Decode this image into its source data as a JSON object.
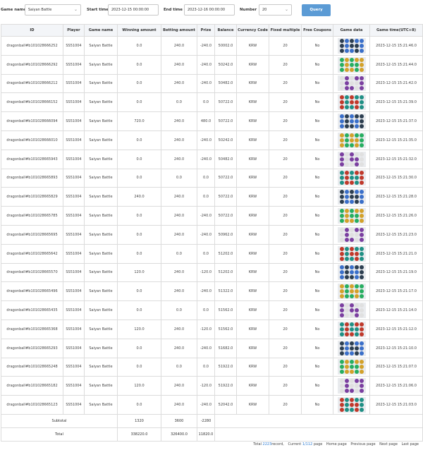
{
  "filters": {
    "game_name_label": "Game name",
    "game_name_value": "Saiyan Battle",
    "start_time_label": "Start time",
    "start_time_value": "2023-12-15 00:00:00",
    "end_time_label": "End time",
    "end_time_value": "2023-12-16 00:00:00",
    "number_label": "Number",
    "number_value": "20",
    "query_label": "Query"
  },
  "table": {
    "headers": [
      "ID",
      "Player",
      "Game name",
      "Winning amount",
      "Betting amount",
      "Prize",
      "Balance",
      "Currency Code",
      "Fixed multiple",
      "Free Coupons",
      "Game data",
      "Game time(UTC+8)"
    ],
    "rows": [
      [
        "dragonball#b101028666252",
        "SS51004",
        "Saiyan Battle",
        "0.0",
        "240.0",
        "-240.0",
        "50002.0",
        "KRW",
        "20",
        "No",
        "2023-12-15 15:21:46.0"
      ],
      [
        "dragonball#b101028666292",
        "SS51004",
        "Saiyan Battle",
        "0.0",
        "240.0",
        "-240.0",
        "50242.0",
        "KRW",
        "20",
        "No",
        "2023-12-15 15:21:44.0"
      ],
      [
        "dragonball#b101028666212",
        "SS51004",
        "Saiyan Battle",
        "0.0",
        "240.0",
        "-240.0",
        "50482.0",
        "KRW",
        "20",
        "No",
        "2023-12-15 15:21:42.0"
      ],
      [
        "dragonball#b101028666152",
        "SS51004",
        "Saiyan Battle",
        "0.0",
        "0.0",
        "0.0",
        "50722.0",
        "KRW",
        "20",
        "No",
        "2023-12-15 15:21:39.0"
      ],
      [
        "dragonball#b101028666094",
        "SS51004",
        "Saiyan Battle",
        "720.0",
        "240.0",
        "480.0",
        "50722.0",
        "KRW",
        "20",
        "No",
        "2023-12-15 15:21:37.0"
      ],
      [
        "dragonball#b101028666010",
        "SS51004",
        "Saiyan Battle",
        "0.0",
        "240.0",
        "-240.0",
        "50242.0",
        "KRW",
        "20",
        "No",
        "2023-12-15 15:21:35.0"
      ],
      [
        "dragonball#b101028665943",
        "SS51004",
        "Saiyan Battle",
        "0.0",
        "240.0",
        "-240.0",
        "50482.0",
        "KRW",
        "20",
        "No",
        "2023-12-15 15:21:32.0"
      ],
      [
        "dragonball#b101028665893",
        "SS51004",
        "Saiyan Battle",
        "0.0",
        "0.0",
        "0.0",
        "50722.0",
        "KRW",
        "20",
        "No",
        "2023-12-15 15:21:30.0"
      ],
      [
        "dragonball#b101028665829",
        "SS51004",
        "Saiyan Battle",
        "240.0",
        "240.0",
        "0.0",
        "50722.0",
        "KRW",
        "20",
        "No",
        "2023-12-15 15:21:28.0"
      ],
      [
        "dragonball#b101028665785",
        "SS51004",
        "Saiyan Battle",
        "0.0",
        "240.0",
        "-240.0",
        "50722.0",
        "KRW",
        "20",
        "No",
        "2023-12-15 15:21:26.0"
      ],
      [
        "dragonball#b101028665695",
        "SS51004",
        "Saiyan Battle",
        "0.0",
        "240.0",
        "-240.0",
        "50962.0",
        "KRW",
        "20",
        "No",
        "2023-12-15 15:21:23.0"
      ],
      [
        "dragonball#b101028665642",
        "SS51004",
        "Saiyan Battle",
        "0.0",
        "0.0",
        "0.0",
        "51202.0",
        "KRW",
        "20",
        "No",
        "2023-12-15 15:21:21.0"
      ],
      [
        "dragonball#b101028665570",
        "SS51004",
        "Saiyan Battle",
        "120.0",
        "240.0",
        "-120.0",
        "51202.0",
        "KRW",
        "20",
        "No",
        "2023-12-15 15:21:19.0"
      ],
      [
        "dragonball#b101028665496",
        "SS51004",
        "Saiyan Battle",
        "0.0",
        "240.0",
        "-240.0",
        "51322.0",
        "KRW",
        "20",
        "No",
        "2023-12-15 15:21:17.0"
      ],
      [
        "dragonball#b101028665435",
        "SS51004",
        "Saiyan Battle",
        "0.0",
        "0.0",
        "0.0",
        "51562.0",
        "KRW",
        "20",
        "No",
        "2023-12-15 15:21:14.0"
      ],
      [
        "dragonball#b101028665368",
        "SS51004",
        "Saiyan Battle",
        "120.0",
        "240.0",
        "-120.0",
        "51562.0",
        "KRW",
        "20",
        "No",
        "2023-12-15 15:21:12.0"
      ],
      [
        "dragonball#b101028665293",
        "SS51004",
        "Saiyan Battle",
        "0.0",
        "240.0",
        "-240.0",
        "51682.0",
        "KRW",
        "20",
        "No",
        "2023-12-15 15:21:10.0"
      ],
      [
        "dragonball#b101028665248",
        "SS51004",
        "Saiyan Battle",
        "0.0",
        "0.0",
        "0.0",
        "51922.0",
        "KRW",
        "20",
        "No",
        "2023-12-15 15:21:07.0"
      ],
      [
        "dragonball#b101028665182",
        "SS51004",
        "Saiyan Battle",
        "120.0",
        "240.0",
        "-120.0",
        "51922.0",
        "KRW",
        "20",
        "No",
        "2023-12-15 15:21:06.0"
      ],
      [
        "dragonball#b101028665123",
        "SS51004",
        "Saiyan Battle",
        "0.0",
        "240.0",
        "-240.0",
        "52042.0",
        "KRW",
        "20",
        "No",
        "2023-12-15 15:21:03.0"
      ]
    ],
    "subtotal": {
      "label": "Subtotal",
      "winning": "1320",
      "betting": "3600",
      "prize": "-2280"
    },
    "total": {
      "label": "Total",
      "winning": "338220.0",
      "betting": "326400.0",
      "prize": "11820.0"
    }
  },
  "symbol_colors": [
    "#2c3e50",
    "#1f8f84",
    "#7b3fa0",
    "#d3a12a",
    "#3a6fc9",
    "#c0392b",
    "#e0e0e0",
    "#27ae60"
  ],
  "pagination": {
    "total_prefix": "Total",
    "total_count": "2223",
    "total_suffix": "record,",
    "current_prefix": "Current",
    "current_value": "1/112",
    "current_suffix": "page",
    "home": "Home page",
    "previous": "Previous page",
    "next": "Next page",
    "last": "Last page"
  }
}
